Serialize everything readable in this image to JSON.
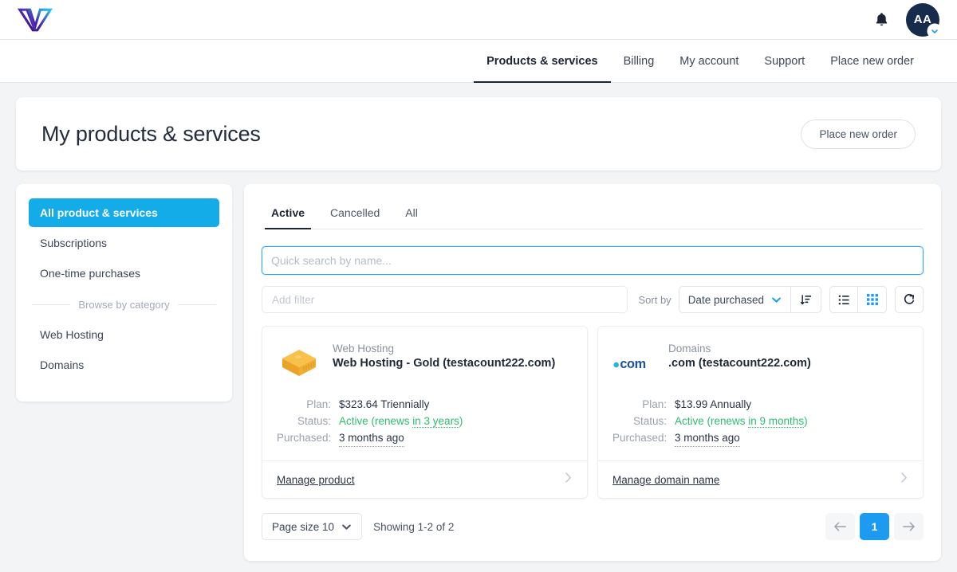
{
  "topbar": {
    "logo_name": "brand-logo",
    "bell_icon": "bell-icon",
    "avatar_initials": "AA",
    "avatar_caret_icon": "chevron-down-icon"
  },
  "nav": {
    "items": [
      {
        "label": "Products & services",
        "active": true
      },
      {
        "label": "Billing",
        "active": false
      },
      {
        "label": "My account",
        "active": false
      },
      {
        "label": "Support",
        "active": false
      },
      {
        "label": "Place new order",
        "active": false
      }
    ]
  },
  "header": {
    "title": "My products & services",
    "place_order_label": "Place new order"
  },
  "sidebar": {
    "items": [
      {
        "label": "All product & services",
        "active": true
      },
      {
        "label": "Subscriptions",
        "active": false
      },
      {
        "label": "One-time purchases",
        "active": false
      }
    ],
    "category_divider": "Browse by category",
    "categories": [
      {
        "label": "Web Hosting"
      },
      {
        "label": "Domains"
      }
    ]
  },
  "main": {
    "tabs": [
      {
        "label": "Active",
        "active": true
      },
      {
        "label": "Cancelled",
        "active": false
      },
      {
        "label": "All",
        "active": false
      }
    ],
    "search": {
      "value": "",
      "placeholder": "Quick search by name..."
    },
    "toolbar": {
      "filter_placeholder": "Add filter",
      "filter_value": "",
      "sort_by_label": "Sort by",
      "sort_value": "Date purchased",
      "sort_caret_icon": "chevron-down-icon",
      "sort_direction_icon": "sort-descending-icon",
      "list_view_icon": "list-view-icon",
      "grid_view_icon": "grid-view-icon",
      "refresh_icon": "refresh-icon"
    },
    "products": [
      {
        "icon": "hosting-box-icon",
        "category": "Web Hosting",
        "name": "Web Hosting - Gold (testacount222.com)",
        "plan_label": "Plan:",
        "plan_value": "$323.64 Triennially",
        "status_label": "Status:",
        "status_prefix": "Active (renews ",
        "status_link": "in 3 years",
        "status_suffix": ")",
        "purchased_label": "Purchased:",
        "purchased_value": "3 months ago",
        "manage_label": "Manage product",
        "chevron_icon": "chevron-right-icon"
      },
      {
        "icon": "dotcom-logo-icon",
        "category": "Domains",
        "name": ".com (testacount222.com)",
        "plan_label": "Plan:",
        "plan_value": "$13.99 Annually",
        "status_label": "Status:",
        "status_prefix": "Active (renews ",
        "status_link": "in 9 months",
        "status_suffix": ")",
        "purchased_label": "Purchased:",
        "purchased_value": "3 months ago",
        "manage_label": "Manage domain name",
        "chevron_icon": "chevron-right-icon"
      }
    ],
    "pagination": {
      "page_size_label": "Page size 10",
      "page_size_caret_icon": "chevron-down-icon",
      "showing": "Showing 1-2 of 2",
      "prev_icon": "arrow-left-icon",
      "next_icon": "arrow-right-icon",
      "current_page": "1"
    }
  },
  "colors": {
    "accent_blue": "#1d9bf0",
    "sidebar_active": "#14ace8",
    "status_green": "#2dbd6e",
    "avatar_navy": "#172b4d"
  }
}
